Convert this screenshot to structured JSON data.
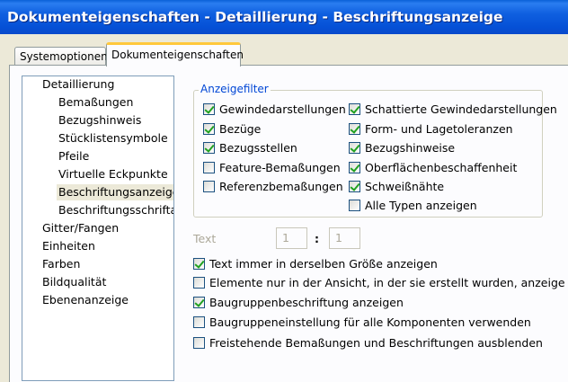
{
  "window": {
    "title": "Dokumenteigenschaften - Detaillierung - Beschriftungsanzeige"
  },
  "tabs": [
    {
      "label": "Systemoptionen",
      "active": false
    },
    {
      "label": "Dokumenteigenschaften",
      "active": true
    }
  ],
  "tree": {
    "items": [
      {
        "label": "Detaillierung",
        "level": 0
      },
      {
        "label": "Bemaßungen",
        "level": 1
      },
      {
        "label": "Bezugshinweis",
        "level": 1
      },
      {
        "label": "Stücklistensymbole",
        "level": 1
      },
      {
        "label": "Pfeile",
        "level": 1
      },
      {
        "label": "Virtuelle Eckpunkte",
        "level": 1
      },
      {
        "label": "Beschriftungsanzeige",
        "level": 1,
        "selected": true
      },
      {
        "label": "Beschriftungsschriftart",
        "level": 1
      },
      {
        "label": "Gitter/Fangen",
        "level": 0
      },
      {
        "label": "Einheiten",
        "level": 0
      },
      {
        "label": "Farben",
        "level": 0
      },
      {
        "label": "Bildqualität",
        "level": 0
      },
      {
        "label": "Ebenenanzeige",
        "level": 0
      }
    ]
  },
  "filter": {
    "legend": "Anzeigefilter",
    "left": [
      {
        "label": "Gewindedarstellungen",
        "checked": true
      },
      {
        "label": "Bezüge",
        "checked": true
      },
      {
        "label": "Bezugsstellen",
        "checked": true
      },
      {
        "label": "Feature-Bemaßungen",
        "checked": false
      },
      {
        "label": "Referenzbemaßungen",
        "checked": false
      }
    ],
    "right": [
      {
        "label": "Schattierte Gewindedarstellungen",
        "checked": true
      },
      {
        "label": "Form- und Lagetoleranzen",
        "checked": true
      },
      {
        "label": "Bezugshinweise",
        "checked": true
      },
      {
        "label": "Oberflächenbeschaffenheit",
        "checked": true
      },
      {
        "label": "Schweißnähte",
        "checked": true
      },
      {
        "label": "Alle Typen anzeigen",
        "checked": false
      }
    ]
  },
  "text_scale": {
    "label": "Text",
    "value1": "1",
    "separator": ":",
    "value2": "1"
  },
  "options": [
    {
      "label": "Text immer in derselben Größe anzeigen",
      "checked": true
    },
    {
      "label": "Elemente nur in der Ansicht, in der sie erstellt wurden, anzeige",
      "checked": false
    },
    {
      "label": "Baugruppenbeschriftung anzeigen",
      "checked": true
    },
    {
      "label": "Baugruppeneinstellung für alle Komponenten verwenden",
      "checked": false
    },
    {
      "label": "Freistehende Bemaßungen und Beschriftungen ausblenden",
      "checked": false
    }
  ]
}
